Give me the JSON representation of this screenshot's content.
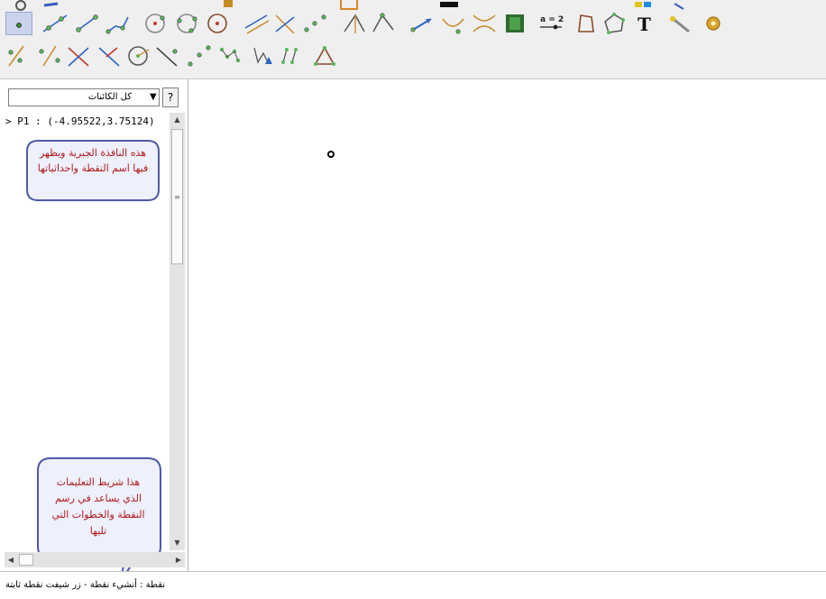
{
  "toolbar": {
    "tools_row1": [
      "point-tool",
      "line-tool",
      "segment-tool",
      "ray-tool",
      "polyline-tool",
      "circle-center-tool",
      "circle-three-points-tool",
      "circle-tool",
      "parallel-line-tool",
      "perpendicular-line-tool",
      "midpoint-tool",
      "angle-bisector-tool",
      "angle-tool",
      "vector-tool",
      "curve-tool",
      "locus-tool",
      "slider-tool",
      "text-tool",
      "polygon-tool",
      "regular-polygon-tool",
      "text-T-tool",
      "move-tool",
      "settings-tool"
    ],
    "slider_label": "a = 2",
    "text_tool_glyph": "T",
    "tools_row2": [
      "point-on-object-tool",
      "intersect-tool",
      "cross-lines-tool",
      "perpendicular-bisector-tool",
      "circle-sector-tool",
      "line-through-tool",
      "reflect-tool",
      "dilate-tool",
      "vector-from-point-tool",
      "rotate-tool",
      "translate-tool",
      "triangle-tool"
    ]
  },
  "algebra": {
    "filter_value": "كل الكائنات",
    "help_label": "?",
    "object_line": "> P1 : (-4.95522,3.75124)"
  },
  "callouts": {
    "algebra_note": "هذه النافذة الجبرية ويظهر فيها اسم النقطة واحداثياتها",
    "instructions_note": "هذا شريط التعليمات الذي يساعد في رسم النقطة والخطوات التي تليها"
  },
  "status": {
    "text": "نقطة : أنشيء نقطة - زر شيفت نقطة ثابتة"
  },
  "colors": {
    "callout_fill": "#eef0fb",
    "callout_border": "#4f5aa6",
    "callout_text": "#b0181a",
    "tool_green": "#2f8f2f",
    "selected_tool_bg": "#c9d3ee"
  }
}
